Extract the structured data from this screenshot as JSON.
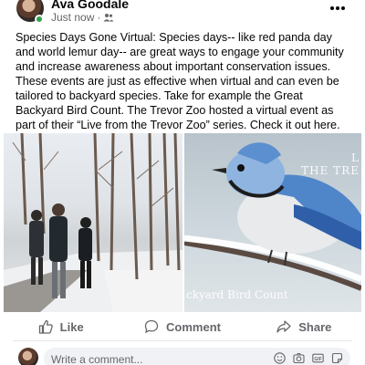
{
  "post": {
    "author": "Ava Goodale",
    "timestamp": "Just now",
    "audience_icon": "friends-icon",
    "more_icon": "more-dots-icon",
    "text": "Species Days Gone Virtual: Species days-- like red panda day and world lemur day-- are great ways to engage your community and increase awareness about important conservation issues. These events are just as effective when virtual and can even be tailored to backyard species. Take for example the Great Backyard Bird Count. The Trevor Zoo hosted a virtual event as part of their “Live from the Trevor Zoo” series. Check it out here.",
    "photos": {
      "right_overlay_top": "L\nTHE TRE",
      "right_overlay_bottom": "ckyard Bird Count"
    }
  },
  "actions": {
    "like": "Like",
    "comment": "Comment",
    "share": "Share"
  },
  "comment_box": {
    "placeholder": "Write a comment..."
  },
  "colors": {
    "secondary_text": "#65676b",
    "online_green": "#31a24c",
    "comment_bg": "#f0f2f5"
  }
}
